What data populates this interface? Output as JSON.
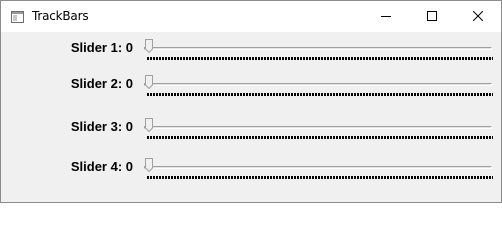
{
  "window": {
    "title": "TrackBars",
    "icon": "app-window-icon",
    "buttons": [
      "minimize-icon",
      "maximize-icon",
      "close-icon"
    ]
  },
  "sliders": [
    {
      "label": "Slider 1: 0",
      "value": 0
    },
    {
      "label": "Slider 2: 0",
      "value": 0
    },
    {
      "label": "Slider 3: 0",
      "value": 0
    },
    {
      "label": "Slider 4: 0",
      "value": 0
    }
  ]
}
